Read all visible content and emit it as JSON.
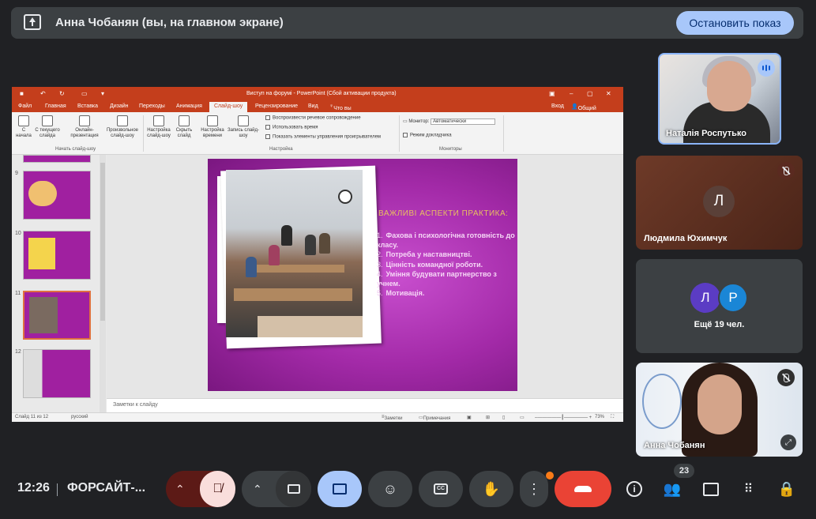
{
  "top_bar": {
    "title": "Анна Чобанян (вы, на главном экране)",
    "stop_button": "Остановить показ"
  },
  "powerpoint": {
    "window_title": "Виступ на форумі - PowerPoint (Сбой активации продукта)",
    "sign_in": "Вход",
    "share": "Общий доступ",
    "menus": [
      "Файл",
      "Главная",
      "Вставка",
      "Дизайн",
      "Переходы",
      "Анимация",
      "Слайд-шоу",
      "Рецензирование",
      "Вид"
    ],
    "active_menu": "Слайд-шоу",
    "tell_me": "Что вы хотите сделать?",
    "ribbon": {
      "from_start": "С начала",
      "from_current": "С текущего слайда",
      "online": "Онлайн-презентация",
      "custom": "Произвольное слайд-шоу",
      "group_start": "Начать слайд-шоу",
      "setup": "Настройка слайд-шоу",
      "hide": "Скрыть слайд",
      "rehearse": "Настройка времени",
      "record": "Запись слайд-шоу",
      "play_narration": "Воспроизвести речевое сопровождение",
      "use_timings": "Использовать время",
      "show_controls": "Показать элементы управления проигрывателем",
      "group_setup": "Настройка",
      "monitor_label": "Монитор:",
      "monitor_value": "Автоматически",
      "presenter_view": "Режим докладчика",
      "group_monitors": "Мониторы"
    },
    "thumbnail_numbers": [
      "9",
      "10",
      "11",
      "12"
    ],
    "slide": {
      "heading": "ВАЖЛИВІ АСПЕКТИ ПРАКТИКА:",
      "items": [
        {
          "n": "1.",
          "text": "Фахова і психологічна готовність до класу."
        },
        {
          "n": "2.",
          "text": "Потреба у наставництві."
        },
        {
          "n": "3.",
          "text": "Цінність командної роботи."
        },
        {
          "n": "4.",
          "text": "Уміння будувати партнерство з учнем."
        },
        {
          "n": "5.",
          "text": "Мотивація."
        }
      ]
    },
    "notes_placeholder": "Заметки к слайду",
    "status": {
      "slide_count": "Слайд 11 из 12",
      "language": "русский",
      "notes": "Заметки",
      "comments": "Примечания",
      "zoom": "73%"
    }
  },
  "participants": {
    "tile1_name": "Наталія Роспутько",
    "tile2_name": "Людмила Юхимчук",
    "tile2_initial": "Л",
    "tile3_initials": [
      "Л",
      "Р"
    ],
    "tile3_more": "Ещё 19 чел.",
    "tile4_name": "Анна Чобанян"
  },
  "bottom_bar": {
    "time": "12:26",
    "meeting_name": "ФОРСАЙТ-...",
    "participants_count": "23"
  },
  "colors": {
    "accent": "#a8c7fa",
    "hangup": "#ea4335",
    "mic_off": "#f9dedc"
  }
}
